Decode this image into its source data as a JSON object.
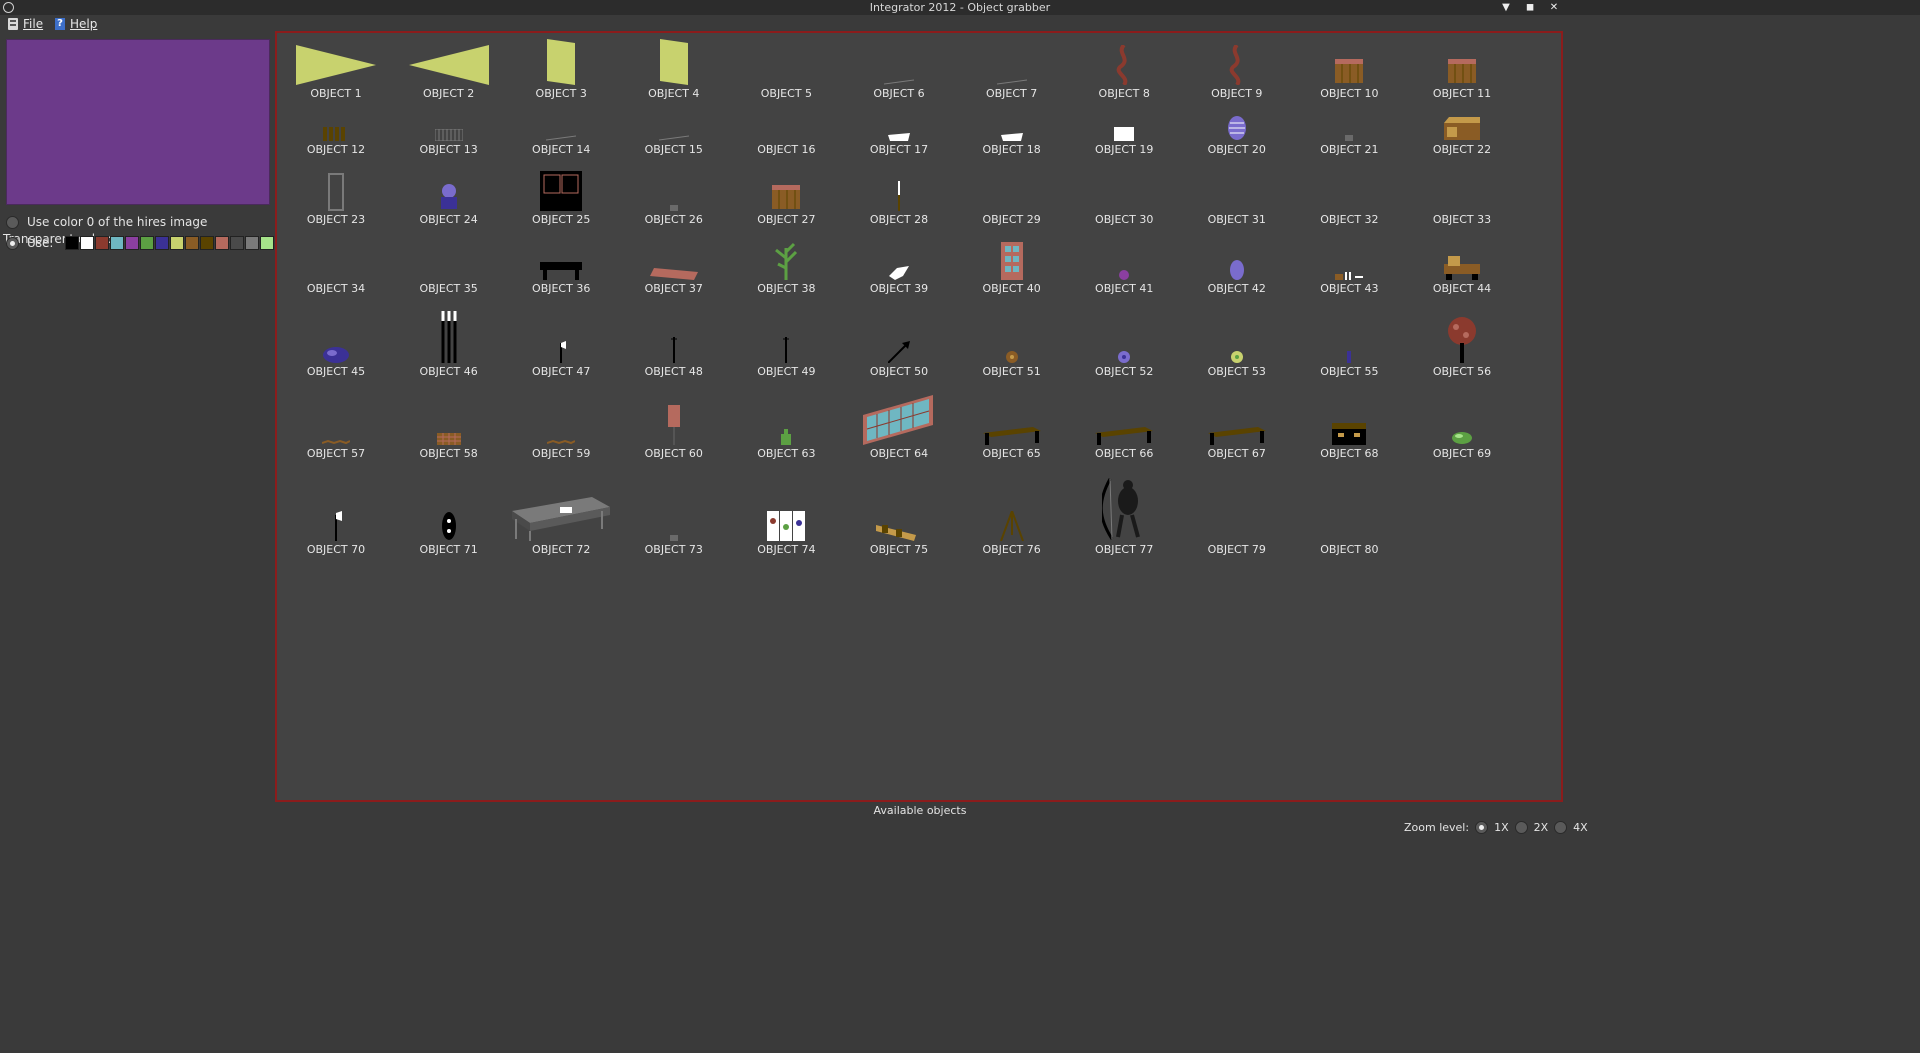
{
  "window": {
    "title": "Integrator 2012 - Object grabber",
    "controls": [
      "minimize-icon",
      "restore-icon",
      "close-icon"
    ]
  },
  "menu": {
    "file": "File",
    "help": "Help"
  },
  "colors": {
    "preview_bg": "#6c3a8a",
    "accent_border": "#8b1c1c",
    "panel_bg": "#434343"
  },
  "left": {
    "transparent_label": "Transparent color:",
    "option_color0": "Use color 0 of the hires image",
    "option_use": "Use:",
    "selected_option": "Use:",
    "palette": [
      "#000000",
      "#ffffff",
      "#8b3a2e",
      "#6fb7c2",
      "#8b3fa0",
      "#5ca043",
      "#3b3196",
      "#c8d26e",
      "#8a5c25",
      "#5a4300",
      "#b56a5e",
      "#4a4a4a",
      "#7a7a7a",
      "#a6e38a",
      "#7a6ccd",
      "#a8a8a8"
    ]
  },
  "objects": [
    {
      "label": "OBJECT 1",
      "icon": "yellow-wedge-right"
    },
    {
      "label": "OBJECT 2",
      "icon": "yellow-wedge-left"
    },
    {
      "label": "OBJECT 3",
      "icon": "yellow-panel"
    },
    {
      "label": "OBJECT 4",
      "icon": "yellow-panel"
    },
    {
      "label": "OBJECT 5",
      "icon": "empty"
    },
    {
      "label": "OBJECT 6",
      "icon": "grey-line"
    },
    {
      "label": "OBJECT 7",
      "icon": "grey-line"
    },
    {
      "label": "OBJECT 8",
      "icon": "red-dragon"
    },
    {
      "label": "OBJECT 9",
      "icon": "red-dragon"
    },
    {
      "label": "OBJECT 10",
      "icon": "brown-crate"
    },
    {
      "label": "OBJECT 11",
      "icon": "brown-crate"
    },
    {
      "label": "OBJECT 12",
      "icon": "dark-fence"
    },
    {
      "label": "OBJECT 13",
      "icon": "grey-grate"
    },
    {
      "label": "OBJECT 14",
      "icon": "grey-line"
    },
    {
      "label": "OBJECT 15",
      "icon": "grey-line"
    },
    {
      "label": "OBJECT 16",
      "icon": "empty"
    },
    {
      "label": "OBJECT 17",
      "icon": "white-slab"
    },
    {
      "label": "OBJECT 18",
      "icon": "white-slab"
    },
    {
      "label": "OBJECT 19",
      "icon": "white-box"
    },
    {
      "label": "OBJECT 20",
      "icon": "purple-egg"
    },
    {
      "label": "OBJECT 21",
      "icon": "grey-dot"
    },
    {
      "label": "OBJECT 22",
      "icon": "brown-chest"
    },
    {
      "label": "OBJECT 23",
      "icon": "grey-door"
    },
    {
      "label": "OBJECT 24",
      "icon": "blue-statue"
    },
    {
      "label": "OBJECT 25",
      "icon": "black-cabinet"
    },
    {
      "label": "OBJECT 26",
      "icon": "grey-dot"
    },
    {
      "label": "OBJECT 27",
      "icon": "brown-crate"
    },
    {
      "label": "OBJECT 28",
      "icon": "white-pole"
    },
    {
      "label": "OBJECT 29",
      "icon": "empty"
    },
    {
      "label": "OBJECT 30",
      "icon": "empty"
    },
    {
      "label": "OBJECT 31",
      "icon": "empty"
    },
    {
      "label": "OBJECT 32",
      "icon": "empty"
    },
    {
      "label": "OBJECT 33",
      "icon": "empty"
    },
    {
      "label": "OBJECT 34",
      "icon": "empty"
    },
    {
      "label": "OBJECT 35",
      "icon": "empty"
    },
    {
      "label": "OBJECT 36",
      "icon": "black-table"
    },
    {
      "label": "OBJECT 37",
      "icon": "salmon-rug"
    },
    {
      "label": "OBJECT 38",
      "icon": "green-plant"
    },
    {
      "label": "OBJECT 39",
      "icon": "white-bird"
    },
    {
      "label": "OBJECT 40",
      "icon": "cyan-window"
    },
    {
      "label": "OBJECT 41",
      "icon": "purple-blob"
    },
    {
      "label": "OBJECT 42",
      "icon": "purple-vase"
    },
    {
      "label": "OBJECT 43",
      "icon": "brown-bench"
    },
    {
      "label": "OBJECT 44",
      "icon": "brown-desk"
    },
    {
      "label": "OBJECT 45",
      "icon": "blue-rock"
    },
    {
      "label": "OBJECT 46",
      "icon": "white-bars"
    },
    {
      "label": "OBJECT 47",
      "icon": "axe"
    },
    {
      "label": "OBJECT 48",
      "icon": "black-pole"
    },
    {
      "label": "OBJECT 49",
      "icon": "black-pole"
    },
    {
      "label": "OBJECT 50",
      "icon": "black-arrow"
    },
    {
      "label": "OBJECT 51",
      "icon": "brown-orb"
    },
    {
      "label": "OBJECT 52",
      "icon": "purple-orb"
    },
    {
      "label": "OBJECT 53",
      "icon": "yellow-orb"
    },
    {
      "label": "OBJECT 55",
      "icon": "blue-sliver"
    },
    {
      "label": "OBJECT 56",
      "icon": "red-tree"
    },
    {
      "label": "OBJECT 57",
      "icon": "brown-line"
    },
    {
      "label": "OBJECT 58",
      "icon": "brown-grate"
    },
    {
      "label": "OBJECT 59",
      "icon": "brown-line"
    },
    {
      "label": "OBJECT 60",
      "icon": "salmon-banner"
    },
    {
      "label": "OBJECT 63",
      "icon": "green-bottle"
    },
    {
      "label": "OBJECT 64",
      "icon": "cyan-screen"
    },
    {
      "label": "OBJECT 65",
      "icon": "olive-bed"
    },
    {
      "label": "OBJECT 66",
      "icon": "olive-bed"
    },
    {
      "label": "OBJECT 67",
      "icon": "olive-bed"
    },
    {
      "label": "OBJECT 68",
      "icon": "black-chest"
    },
    {
      "label": "OBJECT 69",
      "icon": "green-shrub"
    },
    {
      "label": "OBJECT 70",
      "icon": "white-axe"
    },
    {
      "label": "OBJECT 71",
      "icon": "black-shield"
    },
    {
      "label": "OBJECT 72",
      "icon": "grey-bed"
    },
    {
      "label": "OBJECT 73",
      "icon": "grey-dot"
    },
    {
      "label": "OBJECT 74",
      "icon": "white-screen"
    },
    {
      "label": "OBJECT 75",
      "icon": "gold-telescope"
    },
    {
      "label": "OBJECT 76",
      "icon": "brown-tripod"
    },
    {
      "label": "OBJECT 77",
      "icon": "black-archer"
    },
    {
      "label": "OBJECT 79",
      "icon": "empty"
    },
    {
      "label": "OBJECT 80",
      "icon": "empty"
    }
  ],
  "status": "Available objects",
  "zoom": {
    "label": "Zoom level:",
    "options": [
      "1X",
      "2X",
      "4X"
    ],
    "selected": "1X"
  }
}
